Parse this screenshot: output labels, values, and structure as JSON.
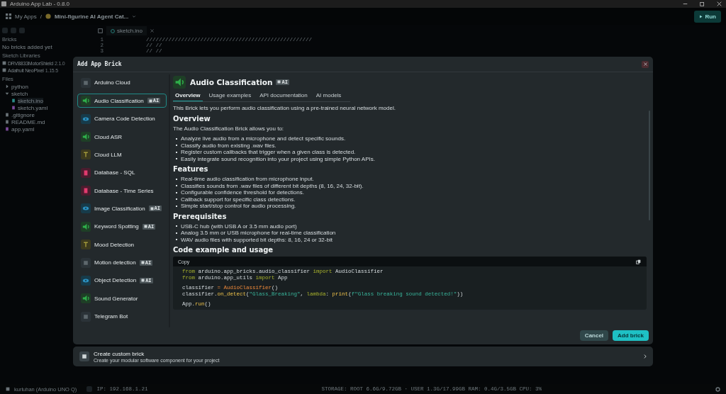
{
  "window": {
    "title": "Arduino App Lab - 0.8.0"
  },
  "header": {
    "breadcrumb": [
      "My Apps",
      "Mini-figurine AI Agent Cat..."
    ],
    "separator": "/",
    "run_button": "Run"
  },
  "sidebar": {
    "sections": [
      {
        "title": "Bricks",
        "items": [
          {
            "label": "No bricks added yet",
            "kind": "note"
          }
        ]
      },
      {
        "title": "Sketch Libraries",
        "items": [
          {
            "label": "DRV8833MotorShield",
            "version": "2.1.0",
            "kind": "library"
          },
          {
            "label": "Adafruit NeoPixel",
            "version": "1.15.5",
            "kind": "library"
          }
        ]
      },
      {
        "title": "Files",
        "tree": [
          {
            "label": "python",
            "kind": "folder",
            "expanded": false
          },
          {
            "label": "sketch",
            "kind": "folder",
            "expanded": true,
            "children": [
              {
                "label": "sketch.ino",
                "kind": "ino",
                "selected": true
              },
              {
                "label": "sketch.yaml",
                "kind": "yaml",
                "selected": false
              }
            ]
          },
          {
            "label": ".gitignore",
            "kind": "file",
            "selected": false
          },
          {
            "label": "README.md",
            "kind": "file",
            "selected": false
          },
          {
            "label": "app.yaml",
            "kind": "yaml",
            "selected": false
          }
        ]
      }
    ]
  },
  "editor": {
    "tab": "sketch.ino",
    "lines": [
      {
        "number": "1",
        "text": "////////////////////////////////////////////////////"
      },
      {
        "number": "2",
        "text": "//    //"
      },
      {
        "number": "3",
        "text": "//               //"
      }
    ]
  },
  "dialog": {
    "title": "Add App Brick",
    "bricks": [
      {
        "label": "Arduino Cloud",
        "kind": "cloud",
        "selected": false
      },
      {
        "label": "Audio Classification",
        "kind": "audio",
        "badge": "AI",
        "selected": true
      },
      {
        "label": "Camera Code Detection",
        "kind": "vision",
        "selected": false
      },
      {
        "label": "Cloud ASR",
        "kind": "audio",
        "selected": false
      },
      {
        "label": "Cloud LLM",
        "kind": "text",
        "selected": false
      },
      {
        "label": "Database - SQL",
        "kind": "database",
        "selected": false
      },
      {
        "label": "Database - Time Series",
        "kind": "database",
        "selected": false
      },
      {
        "label": "Image Classification",
        "kind": "vision",
        "badge": "AI",
        "selected": false
      },
      {
        "label": "Keyword Spotting",
        "kind": "audio",
        "badge": "AI",
        "selected": false
      },
      {
        "label": "Mood Detection",
        "kind": "text",
        "selected": false
      },
      {
        "label": "Motion detection",
        "kind": "cloud",
        "badge": "AI",
        "selected": false
      },
      {
        "label": "Object Detection",
        "kind": "vision",
        "badge": "AI",
        "selected": false
      },
      {
        "label": "Sound Generator",
        "kind": "audio",
        "selected": false
      },
      {
        "label": "Telegram Bot",
        "kind": "cloud",
        "selected": false
      }
    ],
    "detail": {
      "title": "Audio Classification",
      "kind": "audio",
      "badge": "AI",
      "tabs": [
        {
          "label": "Overview",
          "selected": true
        },
        {
          "label": "Usage examples",
          "selected": false
        },
        {
          "label": "API documentation",
          "selected": false
        },
        {
          "label": "AI models",
          "selected": false
        }
      ],
      "blocks": [
        {
          "kind": "paragraph",
          "text": "This Brick lets you perform audio classification using a pre-trained neural network model."
        },
        {
          "kind": "heading",
          "text": "Overview"
        },
        {
          "kind": "paragraph",
          "text": "The Audio Classification Brick allows you to:"
        },
        {
          "kind": "list",
          "items": [
            "Analyze live audio from a microphone and detect specific sounds.",
            "Classify audio from existing .wav files.",
            "Register custom callbacks that trigger when a given class is detected.",
            "Easily integrate sound recognition into your project using simple Python APIs."
          ]
        },
        {
          "kind": "heading",
          "text": "Features"
        },
        {
          "kind": "list",
          "items": [
            "Real-time audio classification from microphone input.",
            "Classifies sounds from .wav files of different bit depths (8, 16, 24, 32-bit).",
            "Configurable confidence threshold for detections.",
            "Callback support for specific class detections.",
            "Simple start/stop control for audio processing."
          ]
        },
        {
          "kind": "heading",
          "text": "Prerequisites"
        },
        {
          "kind": "list",
          "items": [
            "USB-C hub (with USB A or 3.5 mm audio port)",
            "Analog 3.5 mm or USB microphone for real-time classification",
            "WAV audio files with supported bit depths: 8, 16, 24 or 32-bit"
          ]
        },
        {
          "kind": "heading",
          "text": "Code example and usage"
        },
        {
          "kind": "code",
          "copy": "Copy",
          "groups": [
            [
              {
                "segments": [
                  {
                    "kind": "keyword",
                    "text": "from"
                  },
                  {
                    "kind": "plain",
                    "text": " arduino.app_bricks.audio_classifier "
                  },
                  {
                    "kind": "keyword",
                    "text": "import"
                  },
                  {
                    "kind": "plain",
                    "text": " AudioClassifier"
                  }
                ]
              },
              {
                "segments": [
                  {
                    "kind": "keyword",
                    "text": "from"
                  },
                  {
                    "kind": "plain",
                    "text": " arduino.app_utils "
                  },
                  {
                    "kind": "keyword",
                    "text": "import"
                  },
                  {
                    "kind": "plain",
                    "text": " App"
                  }
                ]
              }
            ],
            [
              {
                "segments": [
                  {
                    "kind": "plain",
                    "text": "classifier "
                  },
                  {
                    "kind": "operator",
                    "text": "="
                  },
                  {
                    "kind": "class",
                    "text": " AudioClassifier"
                  },
                  {
                    "kind": "plain",
                    "text": "()"
                  }
                ]
              },
              {
                "segments": [
                  {
                    "kind": "plain",
                    "text": "classifier."
                  },
                  {
                    "kind": "function",
                    "text": "on_detect"
                  },
                  {
                    "kind": "plain",
                    "text": "("
                  },
                  {
                    "kind": "string",
                    "text": "\"Glass_Breaking\""
                  },
                  {
                    "kind": "plain",
                    "text": ", "
                  },
                  {
                    "kind": "keyword",
                    "text": "lambda"
                  },
                  {
                    "kind": "plain",
                    "text": ": "
                  },
                  {
                    "kind": "function",
                    "text": "print"
                  },
                  {
                    "kind": "plain",
                    "text": "("
                  },
                  {
                    "kind": "string",
                    "text": "f\"Glass breaking sound detected!\""
                  },
                  {
                    "kind": "plain",
                    "text": "))"
                  }
                ]
              }
            ],
            [
              {
                "segments": [
                  {
                    "kind": "plain",
                    "text": "App."
                  },
                  {
                    "kind": "function",
                    "text": "run"
                  },
                  {
                    "kind": "plain",
                    "text": "()"
                  }
                ]
              }
            ]
          ]
        }
      ]
    },
    "buttons": [
      {
        "label": "Cancel",
        "kind": "secondary"
      },
      {
        "label": "Add brick",
        "kind": "primary"
      }
    ]
  },
  "custom_brick": {
    "title": "Create custom brick",
    "subtitle": "Create your modular software component for your project"
  },
  "status_bar": {
    "device": "kurluhan (Arduino UNO Q)",
    "ip": "IP: 192.168.1.21",
    "stats": "STORAGE: ROOT 6.6G/9.72GB · USER 1.3G/17.99GB  RAM: 0.4G/3.5GB  CPU: 3%"
  }
}
